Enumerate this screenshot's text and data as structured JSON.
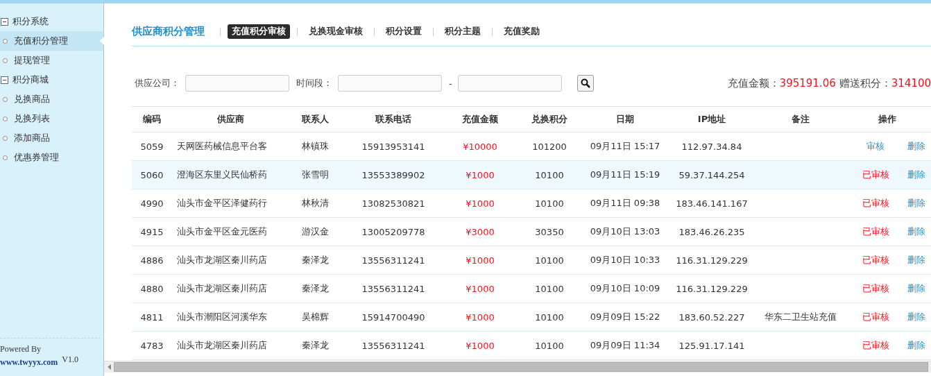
{
  "sidebar": {
    "groups": [
      {
        "label": "积分系统",
        "expanded": true,
        "children": [
          {
            "label": "充值积分管理",
            "selected": true
          },
          {
            "label": "提现管理",
            "selected": false
          }
        ]
      },
      {
        "label": "积分商城",
        "expanded": true,
        "children": [
          {
            "label": "兑换商品",
            "selected": false
          },
          {
            "label": "兑换列表",
            "selected": false
          },
          {
            "label": "添加商品",
            "selected": false
          },
          {
            "label": "优惠券管理",
            "selected": false
          }
        ]
      }
    ],
    "footer": {
      "powered_by": "Powered By",
      "link": "www.twyyx.com",
      "version": "V1.0"
    }
  },
  "header": {
    "title": "供应商积分管理",
    "tabs": [
      {
        "label": "充值积分审核",
        "selected": true
      },
      {
        "label": "兑换现金审核",
        "selected": false
      },
      {
        "label": "积分设置",
        "selected": false
      },
      {
        "label": "积分主题",
        "selected": false
      },
      {
        "label": "充值奖励",
        "selected": false
      }
    ]
  },
  "filter": {
    "company_label": "供应公司：",
    "period_label": "时间段：",
    "dash": "-"
  },
  "totals": {
    "amount_label": "充值金额：",
    "amount": "395191.06",
    "points_label": "赠送积分：",
    "points": "314100"
  },
  "table": {
    "columns": [
      "编码",
      "供应商",
      "联系人",
      "联系电话",
      "充值金额",
      "兑换积分",
      "日期",
      "IP地址",
      "备注",
      "操作"
    ],
    "rows": [
      {
        "id": "5059",
        "supplier": "天网医药械信息平台客",
        "contact": "林镇珠",
        "phone": "15913953141",
        "amount": "¥10000",
        "points": "101200",
        "date": "09月11日 15:17",
        "ip": "112.97.34.84",
        "note": "",
        "status": "审核",
        "audited": false,
        "action": "删除",
        "selected": false
      },
      {
        "id": "5060",
        "supplier": "澄海区东里义民仙桥药",
        "contact": "张雪明",
        "phone": "13553389902",
        "amount": "¥1000",
        "points": "10100",
        "date": "09月11日 15:19",
        "ip": "59.37.144.254",
        "note": "",
        "status": "已审核",
        "audited": true,
        "action": "删除",
        "selected": true
      },
      {
        "id": "4990",
        "supplier": "汕头市金平区泽健药行",
        "contact": "林秋清",
        "phone": "13082530821",
        "amount": "¥1000",
        "points": "10100",
        "date": "09月11日 09:38",
        "ip": "183.46.141.167",
        "note": "",
        "status": "已审核",
        "audited": true,
        "action": "删除",
        "selected": false
      },
      {
        "id": "4915",
        "supplier": "汕头市金平区金元医药",
        "contact": "游汉金",
        "phone": "13005209778",
        "amount": "¥3000",
        "points": "30350",
        "date": "09月10日 13:03",
        "ip": "183.46.26.235",
        "note": "",
        "status": "已审核",
        "audited": true,
        "action": "删除",
        "selected": false
      },
      {
        "id": "4886",
        "supplier": "汕头市龙湖区秦川药店",
        "contact": "秦泽龙",
        "phone": "13556311241",
        "amount": "¥1000",
        "points": "10100",
        "date": "09月10日 10:33",
        "ip": "116.31.129.229",
        "note": "",
        "status": "已审核",
        "audited": true,
        "action": "删除",
        "selected": false
      },
      {
        "id": "4880",
        "supplier": "汕头市龙湖区秦川药店",
        "contact": "秦泽龙",
        "phone": "13556311241",
        "amount": "¥1000",
        "points": "10100",
        "date": "09月10日 10:09",
        "ip": "116.31.129.229",
        "note": "",
        "status": "已审核",
        "audited": true,
        "action": "删除",
        "selected": false
      },
      {
        "id": "4811",
        "supplier": "汕头市潮阳区河溪华东",
        "contact": "吴棉辉",
        "phone": "15914700490",
        "amount": "¥1000",
        "points": "10100",
        "date": "09月09日 15:22",
        "ip": "183.60.52.227",
        "note": "华东二卫生站充值",
        "status": "已审核",
        "audited": true,
        "action": "删除",
        "selected": false
      },
      {
        "id": "4783",
        "supplier": "汕头市龙湖区秦川药店",
        "contact": "秦泽龙",
        "phone": "13556311241",
        "amount": "¥1000",
        "points": "10100",
        "date": "09月09日 11:34",
        "ip": "125.91.17.141",
        "note": "",
        "status": "已审核",
        "audited": true,
        "action": "删除",
        "selected": false
      }
    ]
  }
}
